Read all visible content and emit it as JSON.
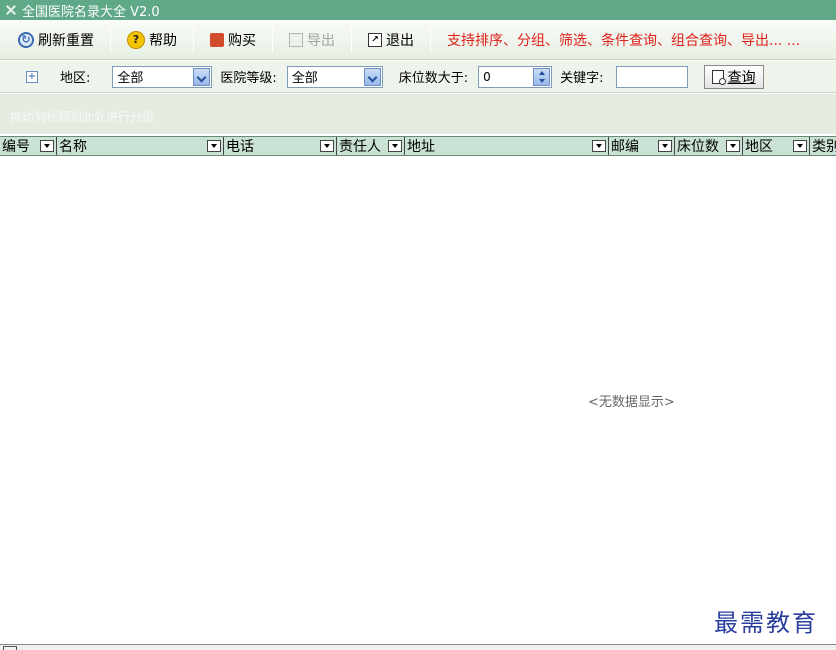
{
  "window": {
    "title": "全国医院名录大全 V2.0",
    "icon": "app-icon"
  },
  "toolbar": {
    "refresh_label": "刷新重置",
    "help_label": "帮助",
    "buy_label": "购买",
    "export_label": "导出",
    "exit_label": "退出",
    "promo_text": "支持排序、分组、筛选、条件查询、组合查询、导出... ...",
    "promo_color": "#e0201c"
  },
  "filters": {
    "region_label": "地区:",
    "region_value": "全部",
    "level_label": "医院等级:",
    "level_value": "全部",
    "beds_label": "床位数大于:",
    "beds_value": "0",
    "keyword_label": "关键字:",
    "keyword_value": "",
    "query_label": "查询"
  },
  "group_panel": {
    "hint": "拖动列标题到此处进行分组"
  },
  "grid": {
    "columns": [
      "编号",
      "名称",
      "电话",
      "责任人",
      "地址",
      "邮编",
      "床位数",
      "地区",
      "类别"
    ],
    "empty_text": "<无数据显示>"
  },
  "watermark": "最需教育",
  "colors": {
    "titlebar": "#5fa888",
    "header": "#c9e2d3"
  }
}
